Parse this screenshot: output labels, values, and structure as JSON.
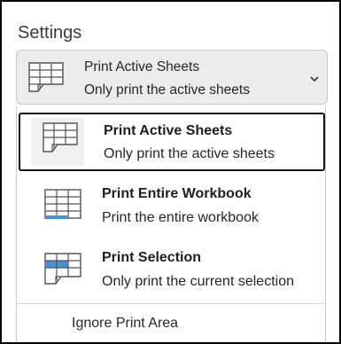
{
  "settings": {
    "title": "Settings"
  },
  "select": {
    "selected_title": "Print Active Sheets",
    "selected_desc": "Only print the active sheets",
    "icon": "sheet-grid-icon",
    "chevron_icon": "chevron-down-icon"
  },
  "options": [
    {
      "title": "Print Active Sheets",
      "desc": "Only print the active sheets",
      "icon": "active-sheets-icon",
      "selected": true
    },
    {
      "title": "Print Entire Workbook",
      "desc": "Print the entire workbook",
      "icon": "entire-workbook-icon",
      "selected": false
    },
    {
      "title": "Print Selection",
      "desc": "Only print the current selection",
      "icon": "selection-icon",
      "selected": false
    }
  ],
  "ignore_print_area": "Ignore Print Area",
  "colors": {
    "accent_blue": "#4a90d9",
    "selected_border": "#111111",
    "select_bg": "#ececec"
  }
}
